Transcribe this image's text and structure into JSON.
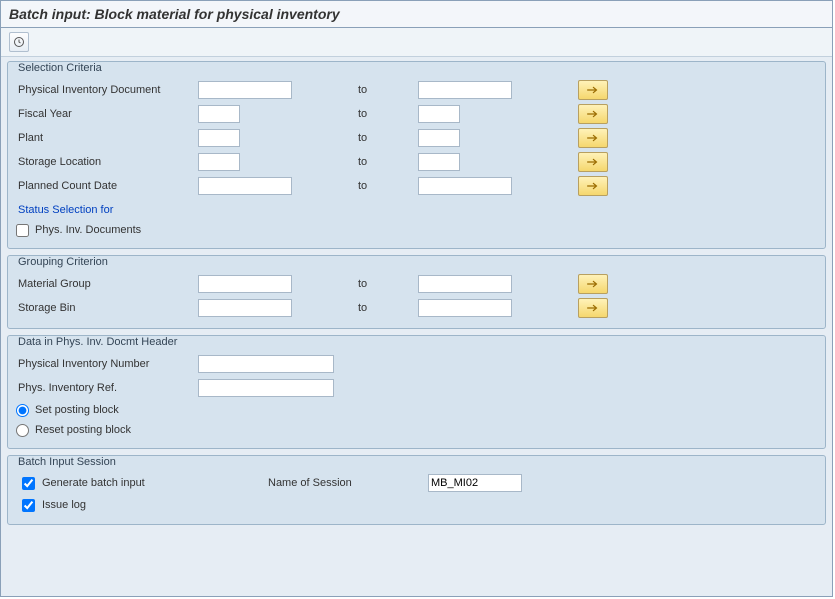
{
  "title": "Batch input: Block material for physical inventory",
  "labels": {
    "to": "to"
  },
  "selection": {
    "legend": "Selection Criteria",
    "phys_inv_doc": {
      "label": "Physical Inventory Document",
      "from": "",
      "to": ""
    },
    "fiscal_year": {
      "label": "Fiscal Year",
      "from": "",
      "to": ""
    },
    "plant": {
      "label": "Plant",
      "from": "",
      "to": ""
    },
    "storage_loc": {
      "label": "Storage Location",
      "from": "",
      "to": ""
    },
    "planned_date": {
      "label": "Planned Count Date",
      "from": "",
      "to": ""
    },
    "status_link": "Status Selection for",
    "phys_inv_docs_chk": {
      "label": "Phys. Inv. Documents",
      "checked": false
    }
  },
  "grouping": {
    "legend": "Grouping Criterion",
    "material_group": {
      "label": "Material Group",
      "from": "",
      "to": ""
    },
    "storage_bin": {
      "label": "Storage Bin",
      "from": "",
      "to": ""
    }
  },
  "header": {
    "legend": "Data in Phys. Inv. Docmt Header",
    "phys_inv_number": {
      "label": "Physical Inventory Number",
      "value": ""
    },
    "phys_inv_ref": {
      "label": "Phys. Inventory Ref.",
      "value": ""
    },
    "set_block": {
      "label": "Set posting block",
      "checked": true
    },
    "reset_block": {
      "label": "Reset posting block",
      "checked": false
    }
  },
  "session": {
    "legend": "Batch Input Session",
    "generate": {
      "label": "Generate batch input",
      "checked": true
    },
    "name_label": "Name of Session",
    "name_value": "MB_MI02",
    "issue_log": {
      "label": "Issue log",
      "checked": true
    }
  }
}
